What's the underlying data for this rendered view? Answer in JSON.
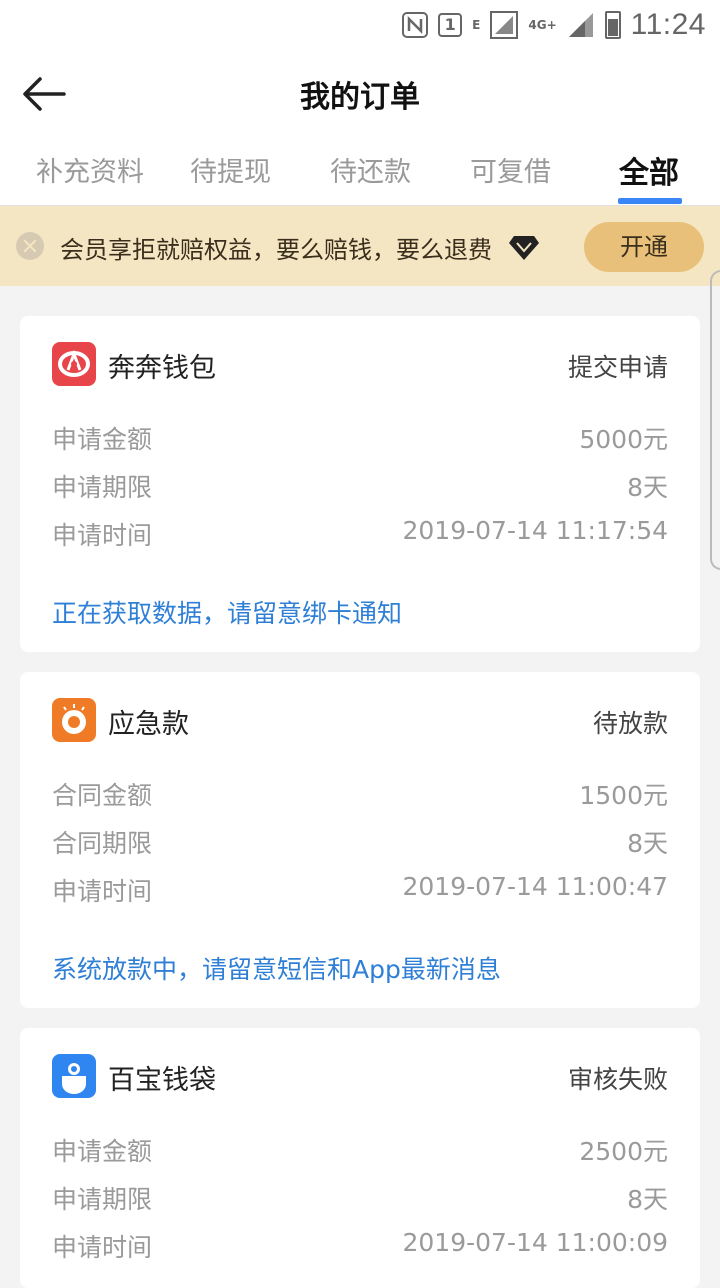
{
  "status_bar": {
    "sim": "1",
    "network_e": "E",
    "network_4g": "4G+",
    "time": "11:24"
  },
  "header": {
    "title": "我的订单"
  },
  "tabs": [
    {
      "label": "补充资料",
      "active": false
    },
    {
      "label": "待提现",
      "active": false
    },
    {
      "label": "待还款",
      "active": false
    },
    {
      "label": "可复借",
      "active": false
    },
    {
      "label": "全部",
      "active": true
    }
  ],
  "banner": {
    "text": "会员享拒就赔权益，要么赔钱，要么退费",
    "button": "开通"
  },
  "orders": [
    {
      "name": "奔奔钱包",
      "status": "提交申请",
      "logo_color": "#e8454b",
      "rows": [
        {
          "label": "申请金额",
          "value": "5000元"
        },
        {
          "label": "申请期限",
          "value": "8天"
        },
        {
          "label": "申请时间",
          "value": "2019-07-14 11:17:54"
        }
      ],
      "note": "正在获取数据，请留意绑卡通知"
    },
    {
      "name": "应急款",
      "status": "待放款",
      "logo_color": "#f07b26",
      "rows": [
        {
          "label": "合同金额",
          "value": "1500元"
        },
        {
          "label": "合同期限",
          "value": "8天"
        },
        {
          "label": "申请时间",
          "value": "2019-07-14 11:00:47"
        }
      ],
      "note": "系统放款中，请留意短信和App最新消息"
    },
    {
      "name": "百宝钱袋",
      "status": "审核失败",
      "logo_color": "#2f86f0",
      "rows": [
        {
          "label": "申请金额",
          "value": "2500元"
        },
        {
          "label": "申请期限",
          "value": "8天"
        },
        {
          "label": "申请时间",
          "value": "2019-07-14 11:00:09"
        }
      ]
    }
  ]
}
